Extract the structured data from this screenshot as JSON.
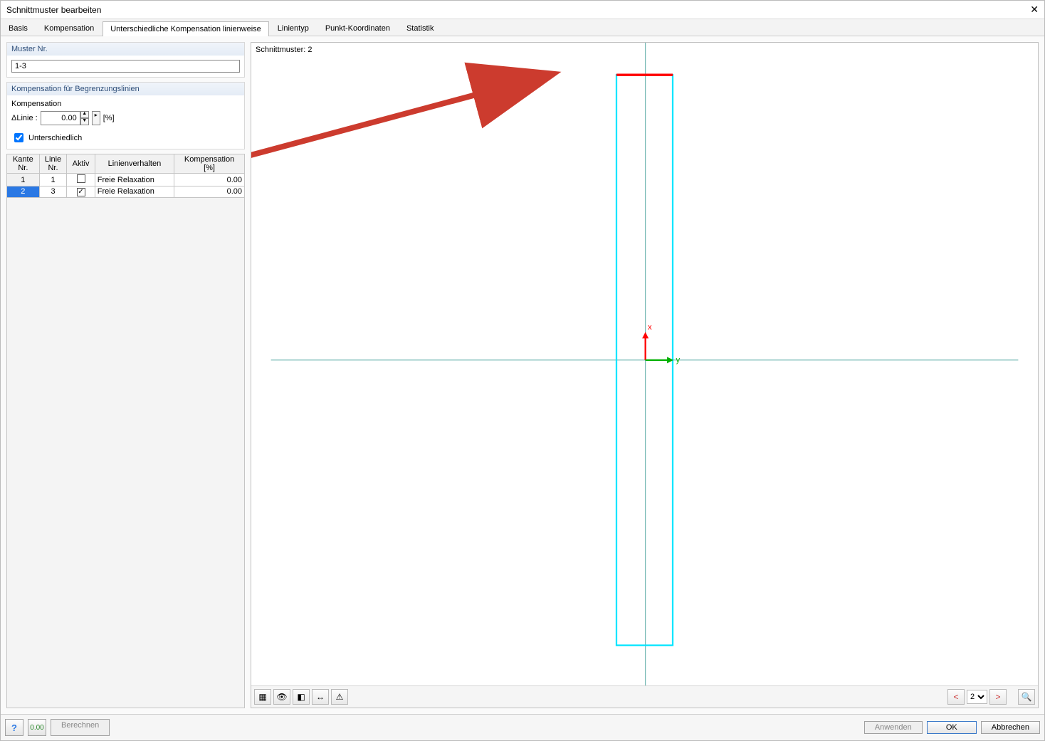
{
  "window_title": "Schnittmuster bearbeiten",
  "tabs": [
    "Basis",
    "Kompensation",
    "Unterschiedliche Kompensation linienweise",
    "Linientyp",
    "Punkt-Koordinaten",
    "Statistik"
  ],
  "active_tab_index": 2,
  "muster_nr": {
    "header": "Muster Nr.",
    "value": "1-3"
  },
  "kompensation_box": {
    "header": "Kompensation für Begrenzungslinien",
    "label_kompensation": "Kompensation",
    "delta_label": "ΔLinie :",
    "value": "0.00",
    "unit": "[%]",
    "checkbox_label": "Unterschiedlich",
    "checkbox_checked": true
  },
  "grid": {
    "headers": {
      "kante_nr": "Kante\nNr.",
      "linie_nr": "Linie\nNr.",
      "aktiv": "Aktiv",
      "linienverhalten": "Linienverhalten",
      "kompensation": "Kompensation\n[%]"
    },
    "rows": [
      {
        "kante": "1",
        "linie": "1",
        "aktiv": false,
        "verhalten": "Freie Relaxation",
        "komp": "0.00",
        "selected": false
      },
      {
        "kante": "2",
        "linie": "3",
        "aktiv": true,
        "verhalten": "Freie Relaxation",
        "komp": "0.00",
        "selected": true
      }
    ]
  },
  "preview": {
    "label": "Schnittmuster: 2"
  },
  "preview_toolbar": {
    "icons_left": [
      "layers-icon",
      "eye-icon",
      "shape-icon",
      "dimension-icon",
      "warning-icon"
    ],
    "pager_value": "2"
  },
  "footer": {
    "help_icon": "?",
    "berechnen": "Berechnen",
    "anwenden": "Anwenden",
    "ok": "OK",
    "abbrechen": "Abbrechen"
  }
}
